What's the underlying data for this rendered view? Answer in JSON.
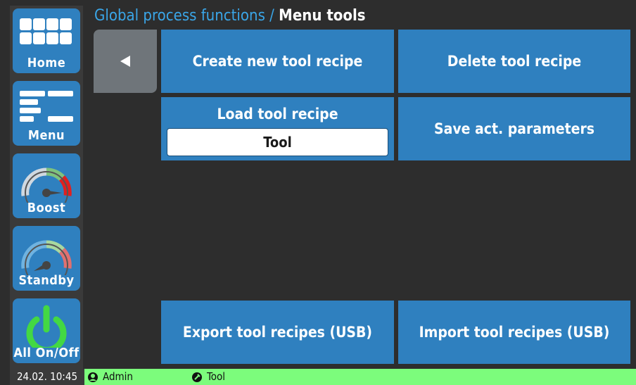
{
  "header": {
    "path": "Global process functions",
    "separator": " / ",
    "current": "Menu tools"
  },
  "sidebar": {
    "items": [
      {
        "label": "Home",
        "icon": "home-grid-icon"
      },
      {
        "label": "Menu",
        "icon": "menu-icon"
      },
      {
        "label": "Boost",
        "icon": "boost-gauge-icon"
      },
      {
        "label": "Standby",
        "icon": "standby-gauge-icon"
      },
      {
        "label": "All On/Off",
        "icon": "power-icon"
      }
    ]
  },
  "main": {
    "back_icon": "back-arrow-icon",
    "create": "Create new tool recipe",
    "delete": "Delete tool recipe",
    "load_label": "Load tool recipe",
    "load_value": "Tool",
    "save": "Save act. parameters",
    "export": "Export tool recipes (USB)",
    "import": "Import tool recipes (USB)"
  },
  "status": {
    "datetime": "24.02. 10:45",
    "user": "Admin",
    "tool": "Tool"
  },
  "colors": {
    "accent": "#2f80bf",
    "status_bar": "#7cfc7c",
    "title_path": "#3aa6e8",
    "background": "#2d2d2d"
  }
}
